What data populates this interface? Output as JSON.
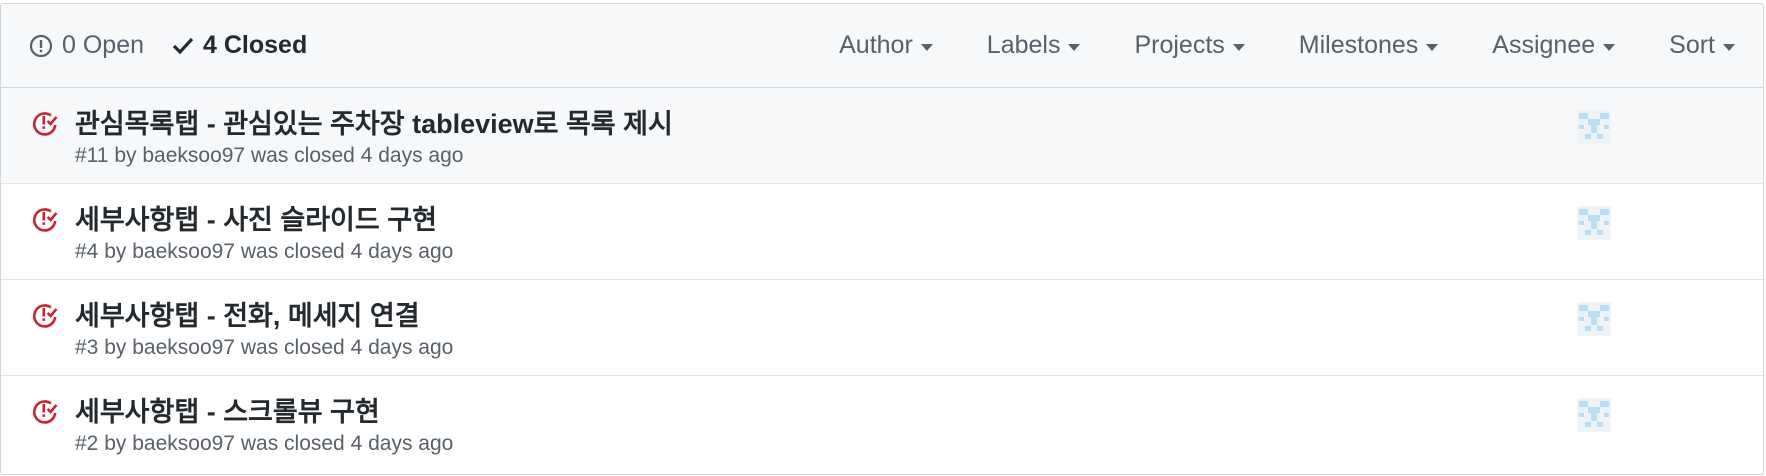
{
  "header": {
    "open_label": "0 Open",
    "closed_label": "4 Closed",
    "filters": [
      "Author",
      "Labels",
      "Projects",
      "Milestones",
      "Assignee",
      "Sort"
    ]
  },
  "colors": {
    "closed_icon": "#cb2431",
    "avatar_pattern": "#b6def5"
  },
  "issues": [
    {
      "title": "관심목록탭 - 관심있는 주차장 tableview로 목록 제시",
      "number": "#11",
      "by": "by",
      "author": "baeksoo97",
      "status": "was closed",
      "time": "4 days ago"
    },
    {
      "title": "세부사항탭 - 사진 슬라이드 구현",
      "number": "#4",
      "by": "by",
      "author": "baeksoo97",
      "status": "was closed",
      "time": "4 days ago"
    },
    {
      "title": "세부사항탭 - 전화, 메세지 연결",
      "number": "#3",
      "by": "by",
      "author": "baeksoo97",
      "status": "was closed",
      "time": "4 days ago"
    },
    {
      "title": "세부사항탭 - 스크롤뷰 구현",
      "number": "#2",
      "by": "by",
      "author": "baeksoo97",
      "status": "was closed",
      "time": "4 days ago"
    }
  ]
}
